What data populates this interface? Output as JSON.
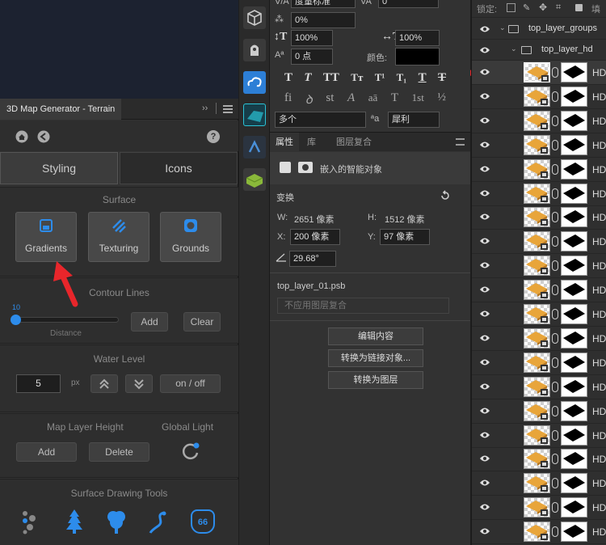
{
  "generator": {
    "title": "3D Map Generator - Terrain",
    "help_icon": "?",
    "tabs": [
      "Styling",
      "Icons"
    ],
    "surface": {
      "title": "Surface",
      "buttons": [
        "Gradients",
        "Texturing",
        "Grounds"
      ]
    },
    "contour": {
      "title": "Contour Lines",
      "slider_value": "10",
      "slider_label": "Distance",
      "add": "Add",
      "clear": "Clear"
    },
    "water": {
      "title": "Water Level",
      "value": "5",
      "unit": "px",
      "toggle": "on / off"
    },
    "map_layer": {
      "title": "Map Layer Height",
      "add": "Add",
      "delete": "Delete"
    },
    "global_light": {
      "title": "Global Light"
    },
    "drawing": {
      "title": "Surface Drawing Tools",
      "sign_number": "66"
    }
  },
  "character": {
    "font_style": "度量标准",
    "kerning": "0",
    "tracking": "0%",
    "vscale": "100%",
    "hscale": "100%",
    "baseline": "0 点",
    "color_label": "颜色:",
    "language": "多个",
    "aa_icon": "ªa",
    "aa_mode": "犀利",
    "styles_row1": [
      "T",
      "T",
      "TT",
      "Tт",
      "T¹",
      "T₁",
      "T",
      "T"
    ],
    "styles_row2": [
      "fi",
      "ꝺ",
      "st",
      "A",
      "aā",
      "T",
      "1st",
      "½"
    ]
  },
  "properties": {
    "tabs": [
      "属性",
      "库",
      "图层复合"
    ],
    "type_label": "嵌入的智能对象",
    "transform_title": "变换",
    "w_label": "W:",
    "w_value": "2651 像素",
    "h_label": "H:",
    "h_value": "1512 像素",
    "x_label": "X:",
    "x_value": "200 像素",
    "y_label": "Y:",
    "y_value": "97 像素",
    "angle_value": "29.68°",
    "filename": "top_layer_01.psb",
    "comp_select": "不应用图层复合",
    "buttons": [
      "编辑内容",
      "转换为链接对象...",
      "转换为图层"
    ]
  },
  "layers": {
    "lock_label": "锁定:",
    "fill_label": "填",
    "group_top": "top_layer_groups",
    "group_sub": "top_layer_hd",
    "row_label": "HD",
    "row_count": 20
  },
  "colors": {
    "accent": "#2d8ceb",
    "arrow": "#e8262b",
    "panel": "#323232"
  }
}
